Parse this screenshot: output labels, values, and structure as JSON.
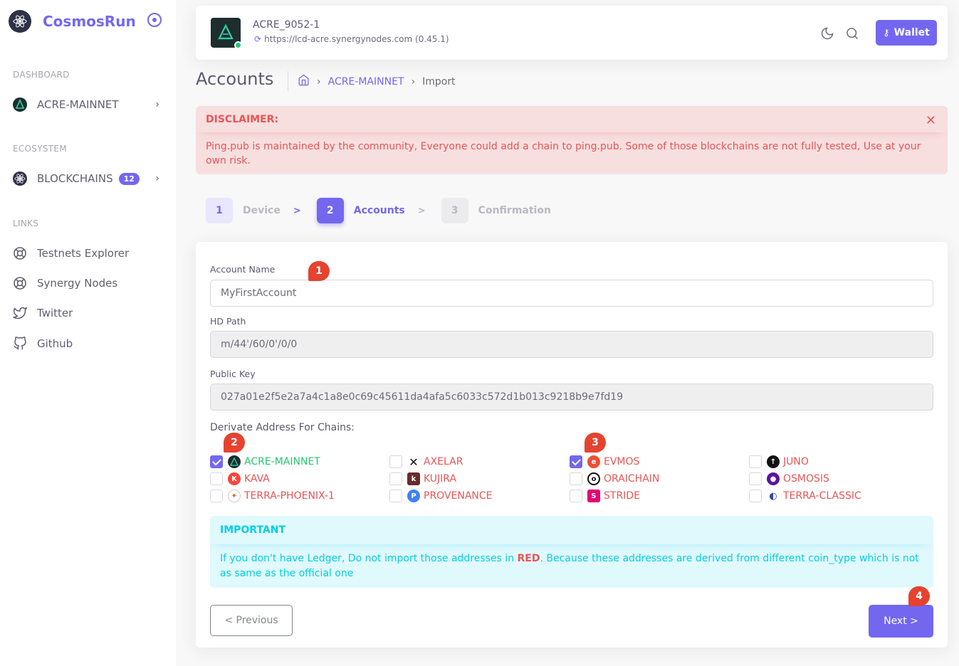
{
  "sidebar": {
    "brand": "CosmosRun",
    "sections": {
      "dashboard": "DASHBOARD",
      "ecosystem": "ECOSYSTEM",
      "links": "LINKS"
    },
    "dashboard_item": "ACRE-MAINNET",
    "blockchains_item": "BLOCKCHAINS",
    "blockchains_count": "12",
    "links": [
      "Testnets Explorer",
      "Synergy Nodes",
      "Twitter",
      "Github"
    ]
  },
  "header": {
    "chain_title": "ACRE_9052-1",
    "chain_url": "https://lcd-acre.synergynodes.com (0.45.1)",
    "wallet_label": "Wallet"
  },
  "page": {
    "title": "Accounts",
    "breadcrumb": [
      "ACRE-MAINNET",
      "Import"
    ]
  },
  "disclaimer": {
    "title": "DISCLAIMER:",
    "body": "Ping.pub is maintained by the community, Everyone could add a chain to ping.pub. Some of those blockchains are not fully tested, Use at your own risk."
  },
  "steps": [
    {
      "num": "1",
      "label": "Device"
    },
    {
      "num": "2",
      "label": "Accounts"
    },
    {
      "num": "3",
      "label": "Confirmation"
    }
  ],
  "form": {
    "account_name_label": "Account Name",
    "account_name_value": "MyFirstAccount",
    "hd_path_label": "HD Path",
    "hd_path_value": "m/44'/60/0'/0/0",
    "public_key_label": "Public Key",
    "public_key_value": "027a01e2f5e2a7a4c1a8e0c69c45611da4afa5c6033c572d1b013c9218b9e7fd19",
    "chains_label": "Derivate Address For Chains:"
  },
  "chains": [
    {
      "name": "ACRE-MAINNET",
      "checked": true,
      "color": "green"
    },
    {
      "name": "AXELAR",
      "checked": false,
      "color": "red"
    },
    {
      "name": "EVMOS",
      "checked": true,
      "color": "red"
    },
    {
      "name": "JUNO",
      "checked": false,
      "color": "red"
    },
    {
      "name": "KAVA",
      "checked": false,
      "color": "red"
    },
    {
      "name": "KUJIRA",
      "checked": false,
      "color": "red"
    },
    {
      "name": "ORAICHAIN",
      "checked": false,
      "color": "red"
    },
    {
      "name": "OSMOSIS",
      "checked": false,
      "color": "red"
    },
    {
      "name": "TERRA-PHOENIX-1",
      "checked": false,
      "color": "red"
    },
    {
      "name": "PROVENANCE",
      "checked": false,
      "color": "red"
    },
    {
      "name": "STRIDE",
      "checked": false,
      "color": "red"
    },
    {
      "name": "TERRA-CLASSIC",
      "checked": false,
      "color": "red"
    }
  ],
  "important": {
    "title": "IMPORTANT",
    "body_pre": "If you don't have Ledger, Do not import those addresses in ",
    "body_red": "RED",
    "body_post": ". Because these addresses are derived from different coin_type which is not as same as the official one"
  },
  "buttons": {
    "previous": "<  Previous",
    "next": "Next  >"
  },
  "markers": [
    "1",
    "2",
    "3",
    "4"
  ],
  "colors": {
    "accent": "#7367f0",
    "danger": "#ea5455",
    "success": "#28c76f",
    "info": "#00cfe8",
    "marker": "#e5432f"
  }
}
